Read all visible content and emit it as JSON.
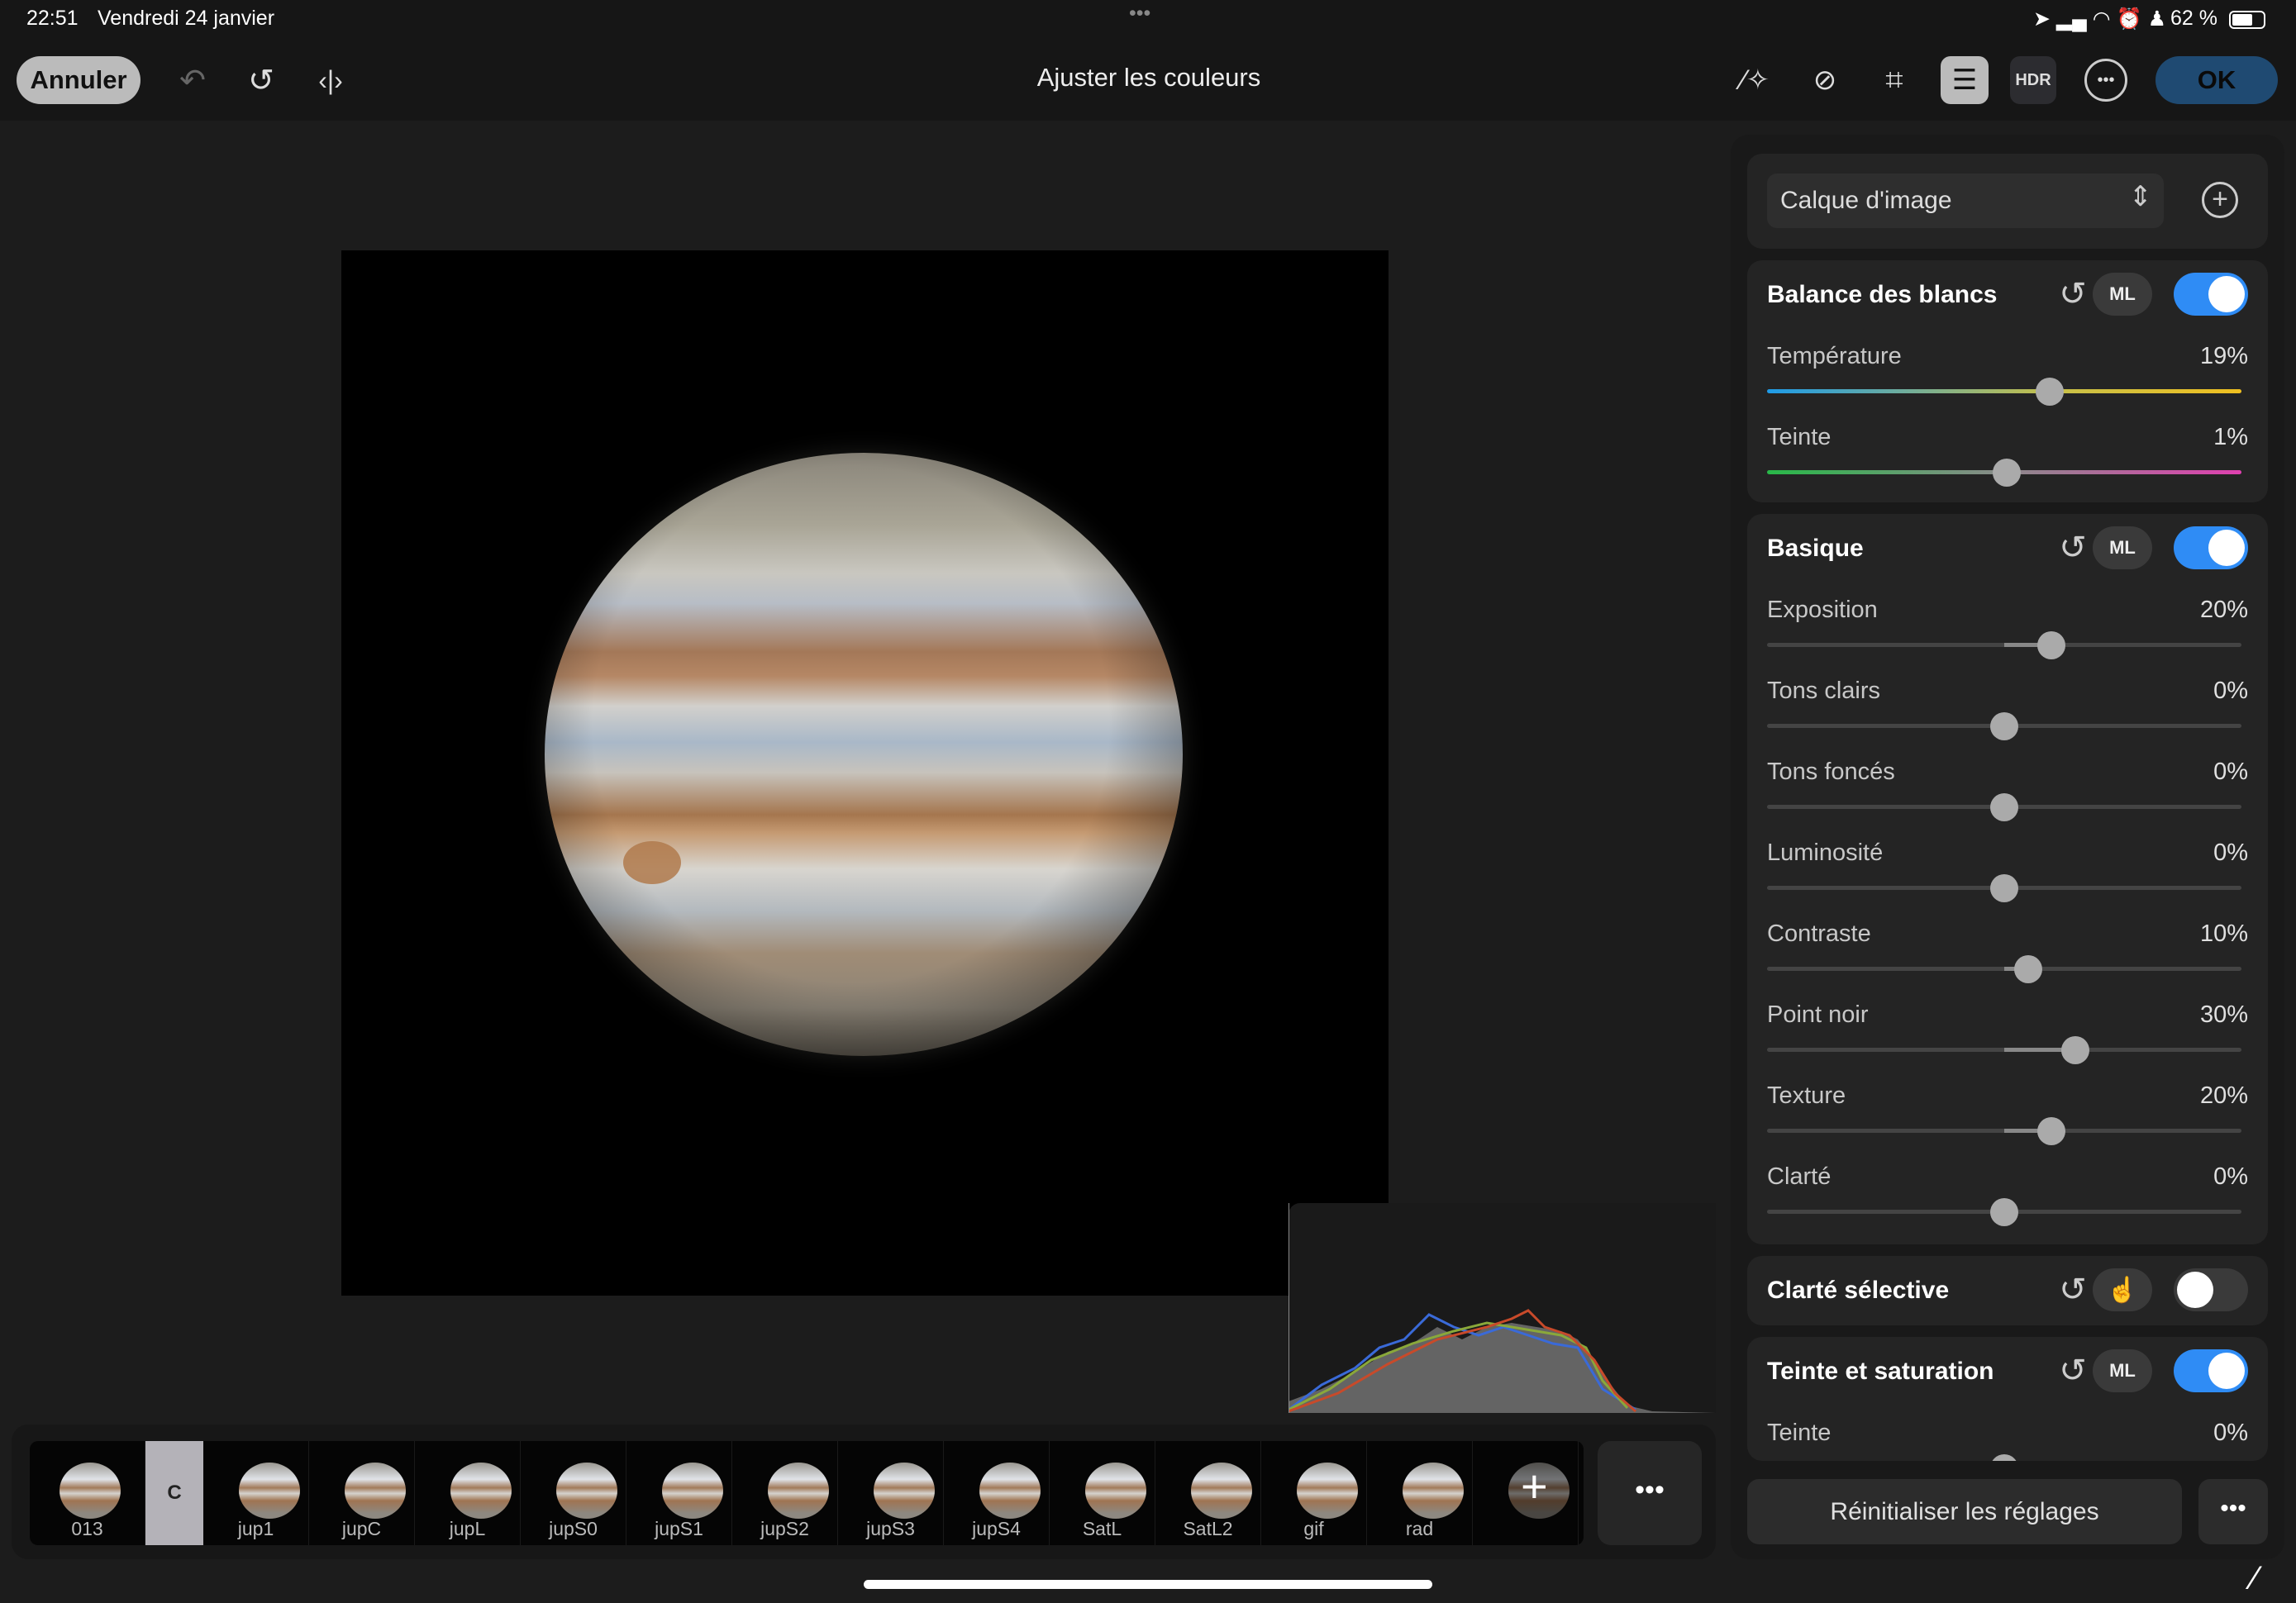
{
  "status": {
    "time": "22:51",
    "date": "Vendredi 24 janvier",
    "battery": "62 %"
  },
  "toolbar": {
    "cancel": "Annuler",
    "title": "Ajuster les couleurs",
    "ok": "OK",
    "hdr": "HDR",
    "ml": "ML"
  },
  "panel": {
    "layer": "Calque d'image",
    "white_balance": {
      "title": "Balance des blancs",
      "ml": "ML",
      "enabled": true,
      "sliders": [
        {
          "label": "Température",
          "value": "19%",
          "v": 19
        },
        {
          "label": "Teinte",
          "value": "1%",
          "v": 1
        }
      ]
    },
    "basic": {
      "title": "Basique",
      "ml": "ML",
      "enabled": true,
      "sliders": [
        {
          "label": "Exposition",
          "value": "20%",
          "v": 20
        },
        {
          "label": "Tons clairs",
          "value": "0%",
          "v": 0
        },
        {
          "label": "Tons foncés",
          "value": "0%",
          "v": 0
        },
        {
          "label": "Luminosité",
          "value": "0%",
          "v": 0
        },
        {
          "label": "Contraste",
          "value": "10%",
          "v": 10
        },
        {
          "label": "Point noir",
          "value": "30%",
          "v": 30
        },
        {
          "label": "Texture",
          "value": "20%",
          "v": 20
        },
        {
          "label": "Clarté",
          "value": "0%",
          "v": 0
        }
      ]
    },
    "selective_clarity": {
      "title": "Clarté sélective",
      "enabled": false
    },
    "hue_sat": {
      "title": "Teinte et saturation",
      "ml": "ML",
      "enabled": true,
      "sliders": [
        {
          "label": "Teinte",
          "value": "0%",
          "v": 0
        }
      ]
    },
    "reset": "Réinitialiser les réglages"
  },
  "filmstrip": {
    "items": [
      "013",
      "C",
      "jup1",
      "jupC",
      "jupL",
      "jupS0",
      "jupS1",
      "jupS2",
      "jupS3",
      "jupS4",
      "SatL",
      "SatL2",
      "gif",
      "rad"
    ]
  },
  "colors": {
    "accent": "#2f8cf5",
    "ok_bg": "#1f4a72"
  }
}
